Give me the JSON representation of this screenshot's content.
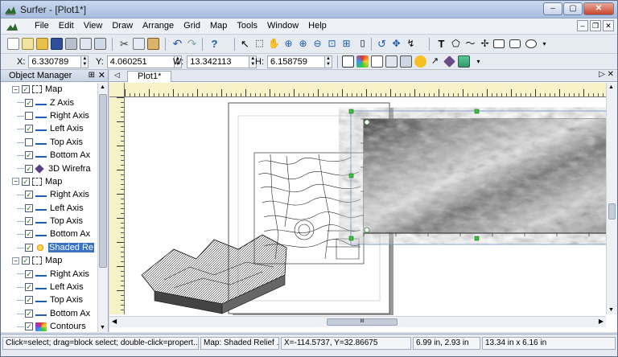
{
  "window": {
    "title": "Surfer - [Plot1*]"
  },
  "menu": {
    "items": [
      "File",
      "Edit",
      "View",
      "Draw",
      "Arrange",
      "Grid",
      "Map",
      "Tools",
      "Window",
      "Help"
    ]
  },
  "coords": {
    "x_label": "X:",
    "x_value": "6.330789",
    "y_label": "Y:",
    "y_value": "4.060251",
    "w_label": "W:",
    "w_value": "13.342113",
    "h_label": "H:",
    "h_value": "6.158759"
  },
  "object_manager": {
    "title": "Object Manager",
    "items": [
      {
        "label": "Map",
        "type": "map",
        "checked": true,
        "level": 0
      },
      {
        "label": "Z Axis",
        "type": "axis",
        "checked": true,
        "level": 1
      },
      {
        "label": "Right Axis",
        "type": "axis",
        "checked": false,
        "level": 1
      },
      {
        "label": "Left Axis",
        "type": "axis",
        "checked": true,
        "level": 1
      },
      {
        "label": "Top Axis",
        "type": "axis",
        "checked": false,
        "level": 1
      },
      {
        "label": "Bottom Ax",
        "type": "axis",
        "checked": true,
        "level": 1
      },
      {
        "label": "3D Wirefra",
        "type": "wire",
        "checked": true,
        "level": 1
      },
      {
        "label": "Map",
        "type": "map",
        "checked": true,
        "level": 0
      },
      {
        "label": "Right Axis",
        "type": "axis",
        "checked": true,
        "level": 1
      },
      {
        "label": "Left Axis",
        "type": "axis",
        "checked": true,
        "level": 1
      },
      {
        "label": "Top Axis",
        "type": "axis",
        "checked": true,
        "level": 1
      },
      {
        "label": "Bottom Ax",
        "type": "axis",
        "checked": true,
        "level": 1
      },
      {
        "label": "Shaded Re",
        "type": "shaded",
        "checked": true,
        "level": 1,
        "selected": true
      },
      {
        "label": "Map",
        "type": "map",
        "checked": true,
        "level": 0
      },
      {
        "label": "Right Axis",
        "type": "axis",
        "checked": true,
        "level": 1
      },
      {
        "label": "Left Axis",
        "type": "axis",
        "checked": true,
        "level": 1
      },
      {
        "label": "Top Axis",
        "type": "axis",
        "checked": true,
        "level": 1
      },
      {
        "label": "Bottom Ax",
        "type": "axis",
        "checked": true,
        "level": 1
      },
      {
        "label": "Contours",
        "type": "contour",
        "checked": true,
        "level": 1
      }
    ]
  },
  "document": {
    "tab_label": "Plot1*",
    "hscroll_grip": "III"
  },
  "status": {
    "hint": "Click=select; drag=block select; double-click=propert...",
    "selection": "Map: Shaded Relief ...",
    "cursor": "X=-114.5737, Y=32.86675",
    "position": "6.99 in, 2.93 in",
    "size": "13.34 in x 6.16 in"
  }
}
